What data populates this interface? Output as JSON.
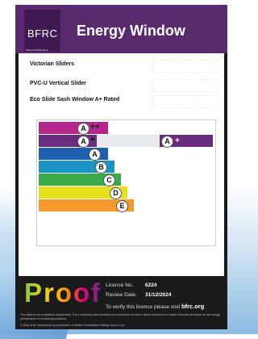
{
  "header": {
    "logo_text": "BFRC",
    "logo_tagline": "Proven Performance",
    "title": "Energy Window"
  },
  "products": [
    {
      "label": "Victorian Sliders"
    },
    {
      "label": "PVC-U Vertical Slider"
    },
    {
      "label": "Eco Slide Sash Window A+ Rated"
    }
  ],
  "scale": [
    {
      "letter": "A",
      "suffix": "++",
      "color": "#b5258c"
    },
    {
      "letter": "A",
      "suffix": "+",
      "color": "#6a2c7f"
    },
    {
      "letter": "A",
      "suffix": "",
      "color": "#1f5fb0"
    },
    {
      "letter": "B",
      "suffix": "",
      "color": "#1c94c3"
    },
    {
      "letter": "C",
      "suffix": "",
      "color": "#3aaa4a"
    },
    {
      "letter": "D",
      "suffix": "",
      "color": "#e5e01c"
    },
    {
      "letter": "E",
      "suffix": "",
      "color": "#f39a2b"
    }
  ],
  "current_rating": {
    "letter": "A",
    "suffix": "+",
    "color": "#6a2c7f"
  },
  "footer": {
    "brand": "Proof",
    "licence_label": "Licence No.",
    "licence_value": "6224",
    "review_label": "Review Date:",
    "review_value": "31/12/2024",
    "verify_text": "To verify this licence please visit",
    "verify_site": "bfrc.org",
    "fine_print_1": "This label is not a statutory requirement. It is a voluntary label provided as a customer service to allow consumers to make informed decisions on the energy performance of competing products.",
    "fine_print_2": "© Only to be reproduced by permission of British Fenestration Rating Council Ltd"
  }
}
